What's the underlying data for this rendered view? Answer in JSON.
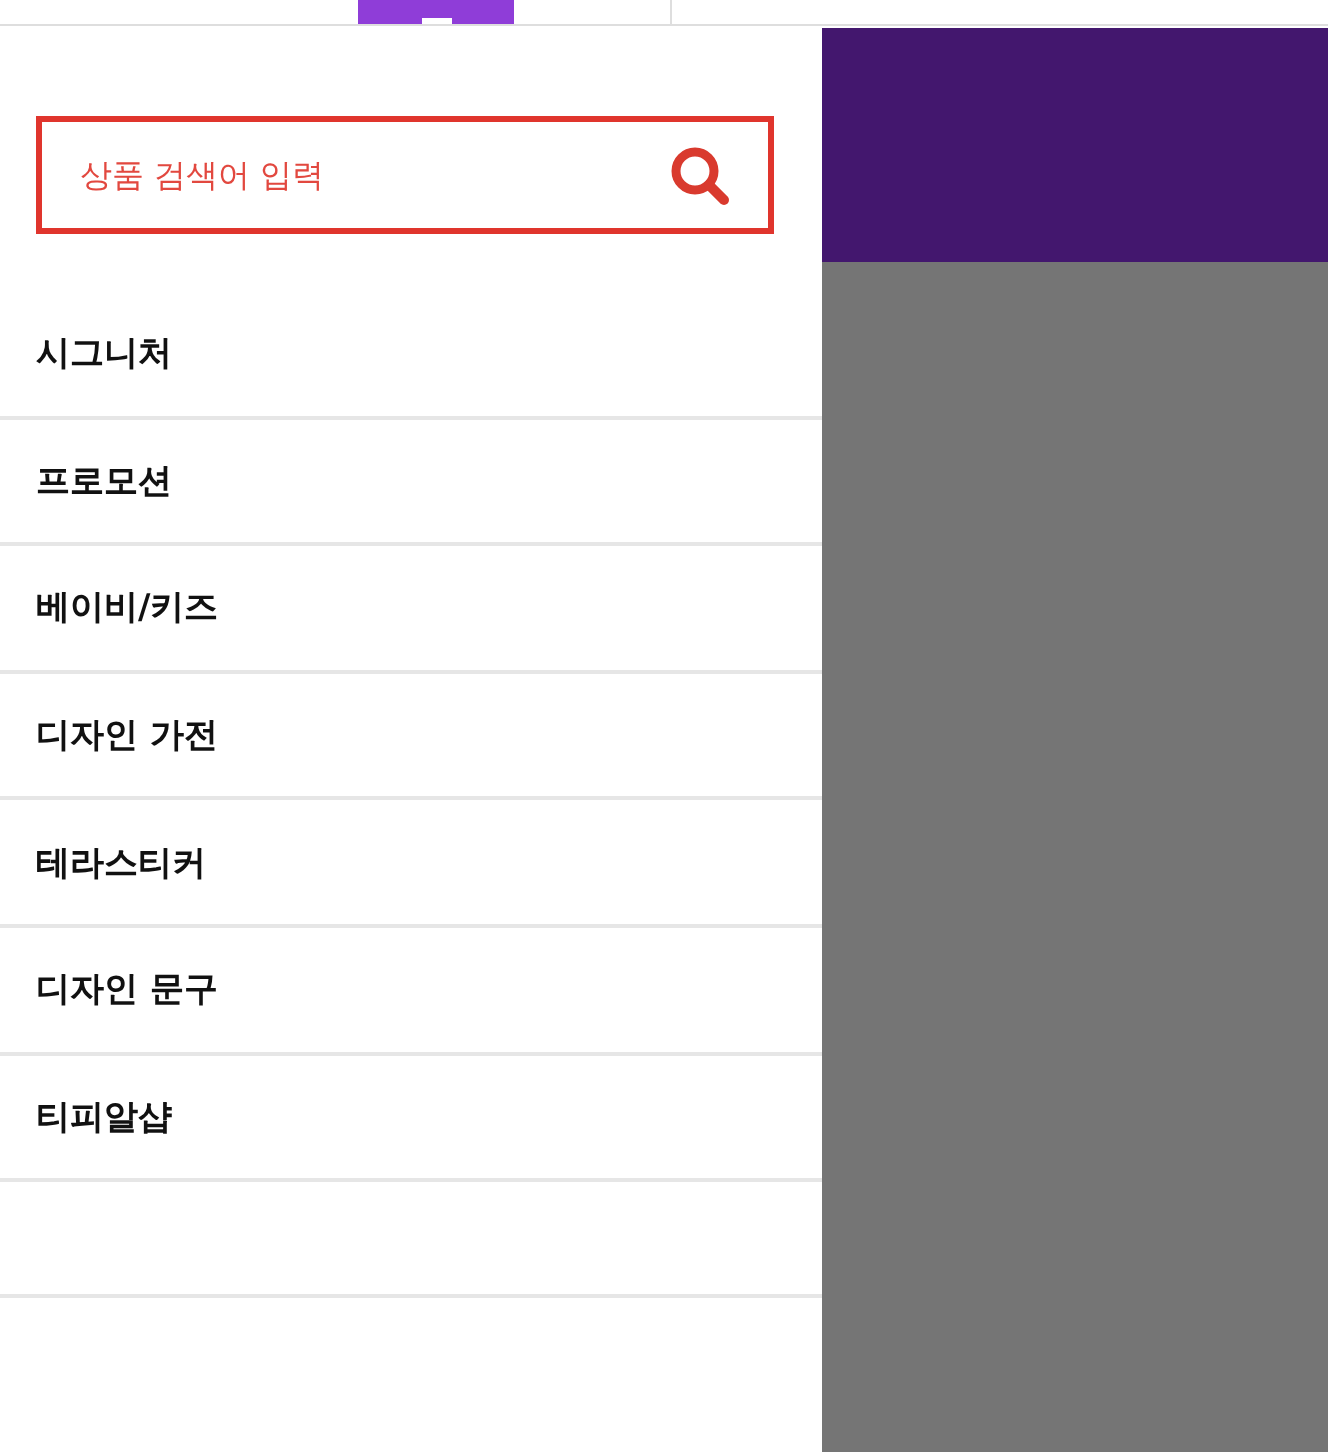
{
  "search": {
    "placeholder": "상품 검색어 입력"
  },
  "menu": {
    "items": [
      {
        "label": "시그니처"
      },
      {
        "label": "프로모션"
      },
      {
        "label": "베이비/키즈"
      },
      {
        "label": "디자인 가전"
      },
      {
        "label": "테라스티커"
      },
      {
        "label": "디자인 문구"
      },
      {
        "label": "티피알샵"
      }
    ]
  }
}
